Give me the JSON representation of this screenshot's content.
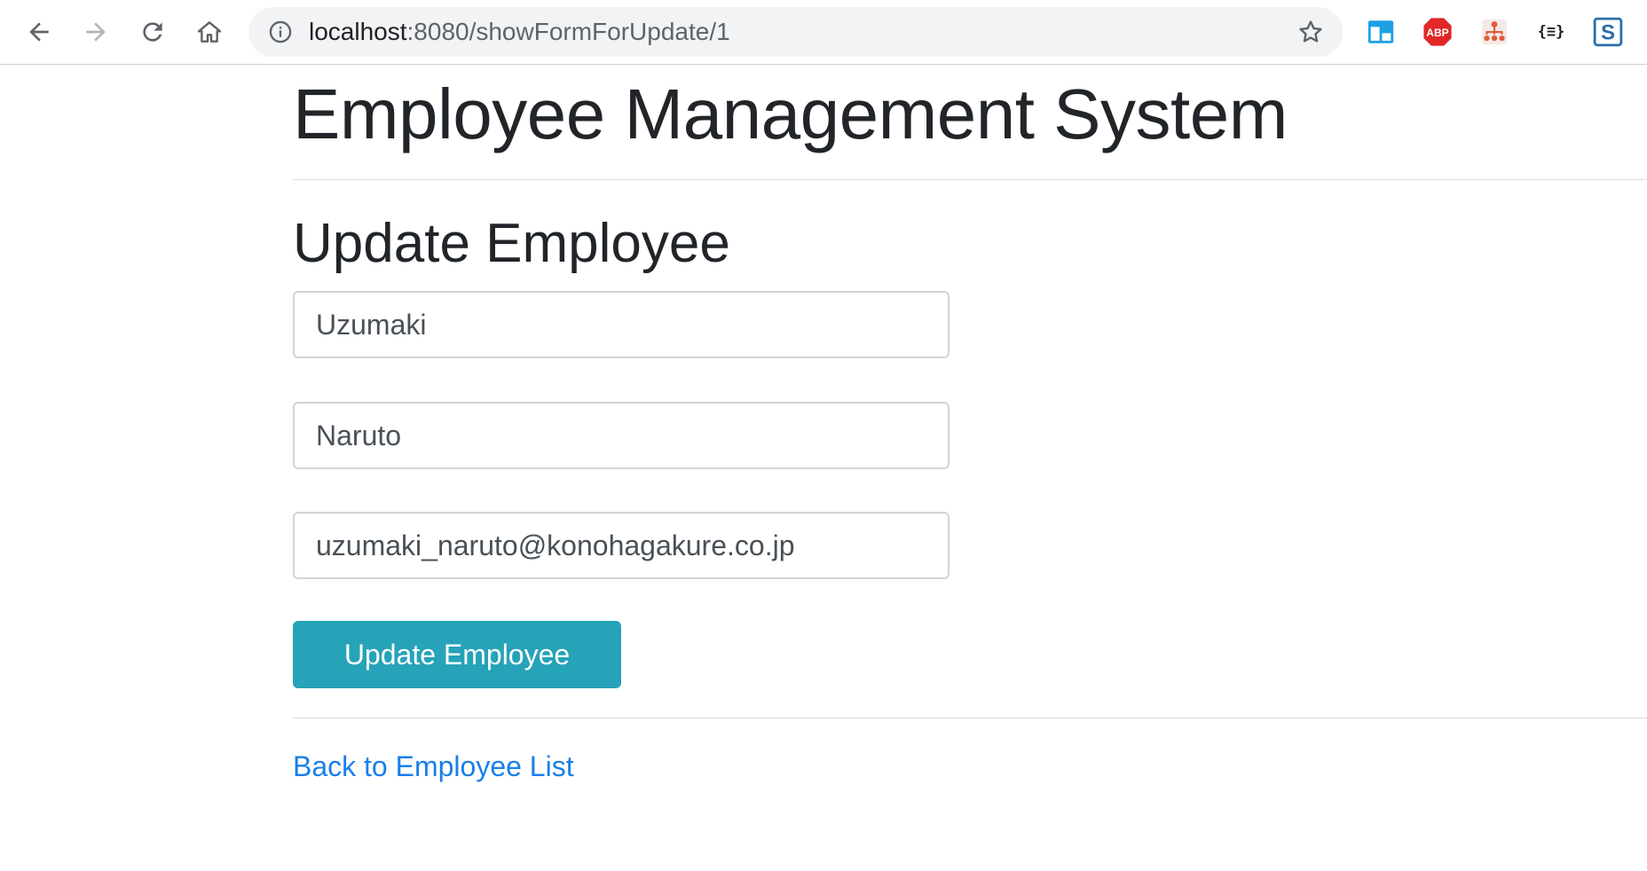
{
  "browser": {
    "url_host": "localhost",
    "url_rest": ":8080/showFormForUpdate/1",
    "extensions": [
      {
        "name": "window-extension-icon"
      },
      {
        "name": "adblock-plus-icon",
        "label": "ABP"
      },
      {
        "name": "sitemap-extension-icon"
      },
      {
        "name": "json-viewer-icon",
        "label": "{≡}"
      },
      {
        "name": "s-extension-icon",
        "label": "S"
      }
    ],
    "colors": {
      "abp_red": "#e12727",
      "ext_blue": "#1da1e4",
      "ext_sitemap": "#e05a3a",
      "ext_s": "#2d6ea8"
    }
  },
  "page": {
    "title": "Employee Management System",
    "form": {
      "heading": "Update Employee",
      "first_name": "Uzumaki",
      "last_name": "Naruto",
      "email": "uzumaki_naruto@konohagakure.co.jp",
      "submit_label": "Update Employee"
    },
    "back_link": "Back to Employee List"
  },
  "colors": {
    "button": "#26a3b8",
    "link": "#1a7fe8",
    "text": "#212529"
  }
}
